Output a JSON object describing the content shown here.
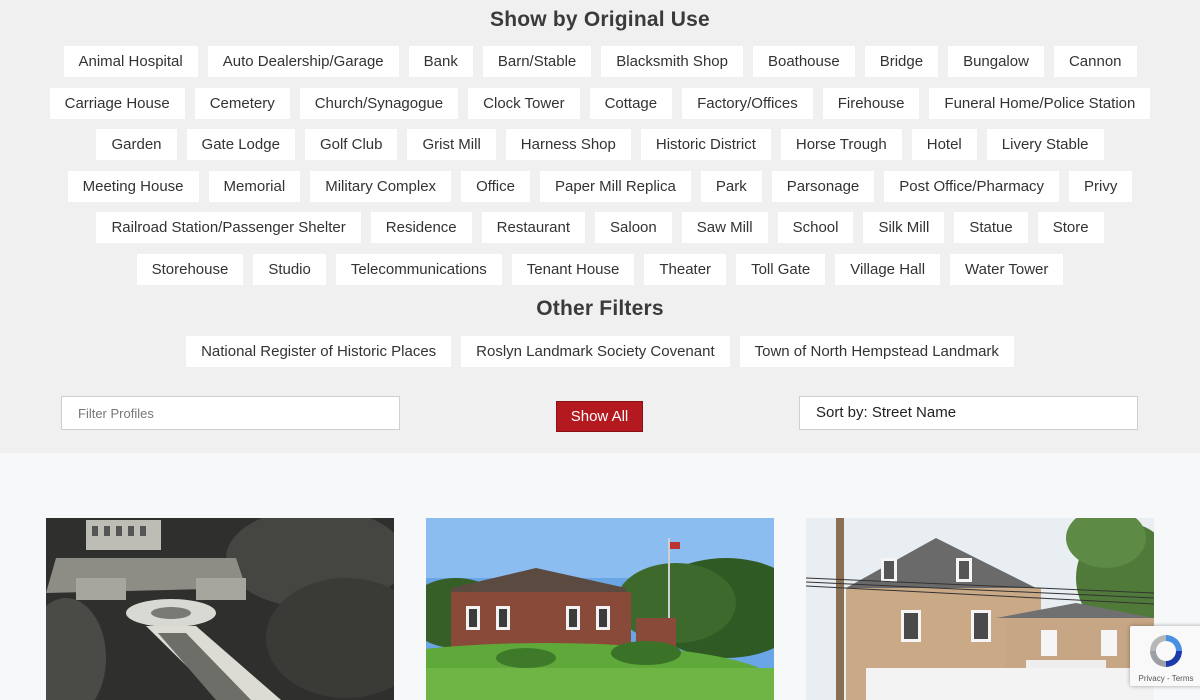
{
  "original_use": {
    "title": "Show by Original Use",
    "rows": [
      [
        "Animal Hospital",
        "Auto Dealership/Garage",
        "Bank",
        "Barn/Stable",
        "Blacksmith Shop",
        "Boathouse",
        "Bridge",
        "Bungalow",
        "Cannon"
      ],
      [
        "Carriage House",
        "Cemetery",
        "Church/Synagogue",
        "Clock Tower",
        "Cottage",
        "Factory/Offices",
        "Firehouse",
        "Funeral Home/Police Station"
      ],
      [
        "Garden",
        "Gate Lodge",
        "Golf Club",
        "Grist Mill",
        "Harness Shop",
        "Historic District",
        "Horse Trough",
        "Hotel",
        "Livery Stable"
      ],
      [
        "Meeting House",
        "Memorial",
        "Military Complex",
        "Office",
        "Paper Mill Replica",
        "Park",
        "Parsonage",
        "Post Office/Pharmacy",
        "Privy"
      ],
      [
        "Railroad Station/Passenger Shelter",
        "Residence",
        "Restaurant",
        "Saloon",
        "Saw Mill",
        "School",
        "Silk Mill",
        "Statue",
        "Store"
      ],
      [
        "Storehouse",
        "Studio",
        "Telecommunications",
        "Tenant House",
        "Theater",
        "Toll Gate",
        "Village Hall",
        "Water Tower"
      ]
    ]
  },
  "other_filters": {
    "title": "Other Filters",
    "items": [
      "National Register of Historic Places",
      "Roslyn Landmark Society Covenant",
      "Town of North Hempstead Landmark"
    ]
  },
  "controls": {
    "filter_placeholder": "Filter Profiles",
    "show_all_label": "Show All",
    "sort_label": "Sort by: Street Name"
  },
  "recaptcha": {
    "links": "Privacy - Terms"
  },
  "colors": {
    "accent": "#b3191e",
    "chip_bg": "#ffffff",
    "page_bg": "#f0f0f1"
  }
}
